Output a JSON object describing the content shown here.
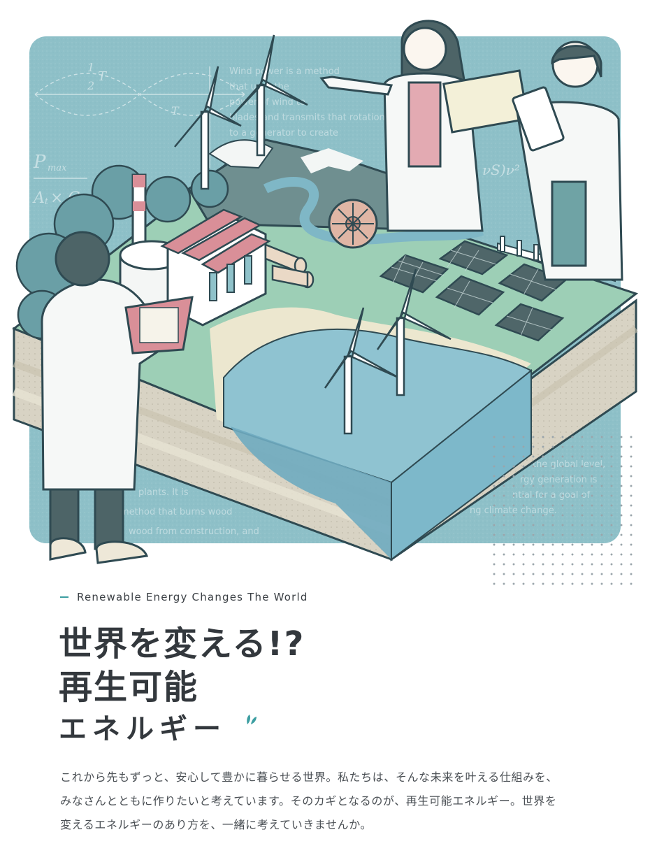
{
  "hero": {
    "bg_text": {
      "top": "Wind power is a method that uses the power of wind to rotate blades and transmits that rotation to a generator to create",
      "top_lines": [
        "Wind power is a method",
        "that uses the",
        "power of wind to",
        "blades and transmits that rotation",
        "to a generator to create"
      ],
      "bottom_left_lines": [
        "plants. It is",
        "method that burns wood",
        "wood from construction, and"
      ],
      "bottom_right_lines": [
        "the global level,",
        "rgy generation is",
        "ntial for a goal of",
        "ng climate change."
      ],
      "formula_fraction": "1/2 T",
      "formula_pmax": "Pmax",
      "formula_area": "A₁×C",
      "formula_v": "vS)v² = 1/2"
    }
  },
  "heading": {
    "eyebrow": "Renewable Energy Changes The World",
    "line1": "世界を変える!?",
    "line2": "再生可能",
    "line3": "エネルギー"
  },
  "intro": {
    "line1": "これから先もずっと、安心して豊かに暮らせる世界。私たちは、そんな未来を叶える仕組みを、",
    "line2": "みなさんとともに作りたいと考えています。そのカギとなるのが、再生可能エネルギー。世界を",
    "line3": "変えるエネルギーのあり方を、一緒に考えていきませんか。"
  },
  "colors": {
    "panel": "#8fc2ca",
    "accent": "#3c9ea1",
    "text": "#33383d",
    "roof": "#d98f98",
    "water": "#7fb7c6"
  }
}
